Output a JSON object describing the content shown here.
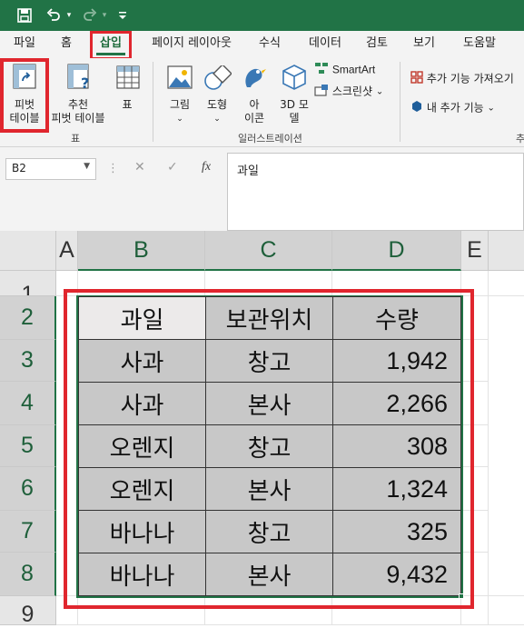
{
  "quick_access": {
    "save_icon": "save-icon",
    "undo_icon": "undo-icon",
    "redo_icon": "redo-icon",
    "customize_icon": "customize-qat-icon"
  },
  "tabs": [
    "파일",
    "홈",
    "삽입",
    "페이지 레이아웃",
    "수식",
    "데이터",
    "검토",
    "보기",
    "도움말"
  ],
  "active_tab": "삽입",
  "ribbon": {
    "pivot_table": "피벗\n테이블",
    "recommended_pivot": "추천\n피벗 테이블",
    "table": "표",
    "tables_group": "표",
    "picture": "그림",
    "shapes": "도형",
    "icons": "아\n이콘",
    "models_3d": "3D 모\n델",
    "smartart": "SmartArt",
    "screenshot": "스크린샷",
    "illustrations_group": "일러스트레이션",
    "get_addins": "추가 기능 가져오기",
    "my_addins": "내 추가 기능",
    "addins_group_partial": "추"
  },
  "formula_bar": {
    "name_box": "B2",
    "fx_label": "fx",
    "content": "과일"
  },
  "columns": [
    "A",
    "B",
    "C",
    "D",
    "E"
  ],
  "rows": [
    "1",
    "2",
    "3",
    "4",
    "5",
    "6",
    "7",
    "8",
    "9"
  ],
  "table": {
    "headers": [
      "과일",
      "보관위치",
      "수량"
    ],
    "rows": [
      [
        "사과",
        "창고",
        "1,942"
      ],
      [
        "사과",
        "본사",
        "2,266"
      ],
      [
        "오렌지",
        "창고",
        "308"
      ],
      [
        "오렌지",
        "본사",
        "1,324"
      ],
      [
        "바나나",
        "창고",
        "325"
      ],
      [
        "바나나",
        "본사",
        "9,432"
      ]
    ]
  },
  "colors": {
    "excel_green": "#217346",
    "highlight_red": "#e0262e",
    "table_fill": "#c8c8c8"
  }
}
